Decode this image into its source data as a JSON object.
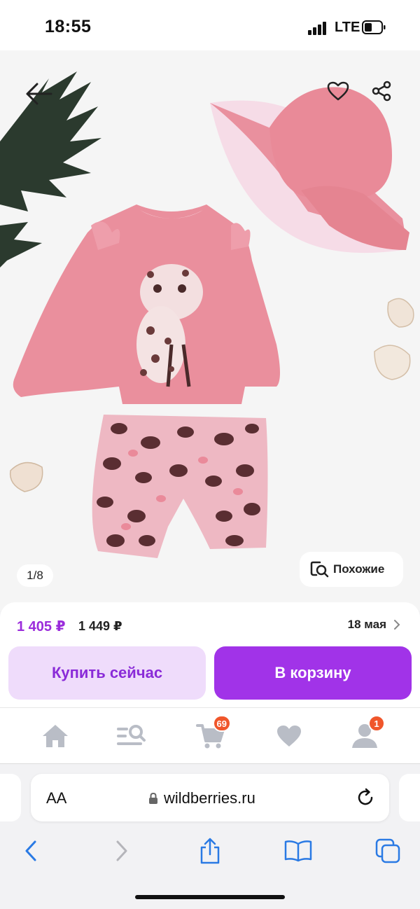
{
  "status_bar": {
    "time": "18:55",
    "network": "LTE"
  },
  "gallery": {
    "counter": "1/8",
    "similar_label": "Похожие"
  },
  "product": {
    "price": "1 405 ₽",
    "old_price": "1 449 ₽",
    "delivery": "18 мая"
  },
  "actions": {
    "buy_now": "Купить сейчас",
    "add_to_cart": "В корзину"
  },
  "nav": {
    "items": [
      {
        "name": "home"
      },
      {
        "name": "catalog-search"
      },
      {
        "name": "cart",
        "badge": "69"
      },
      {
        "name": "favorites"
      },
      {
        "name": "profile",
        "badge": "1"
      }
    ]
  },
  "browser": {
    "aa_label": "AA",
    "url": "wildberries.ru"
  },
  "colors": {
    "accent": "#a133e8",
    "accent_light": "#efdcfb",
    "price": "#9b2cdb",
    "badge": "#f0562b",
    "icon_gray": "#b9bdc6",
    "safari_blue": "#2a7ae4"
  }
}
